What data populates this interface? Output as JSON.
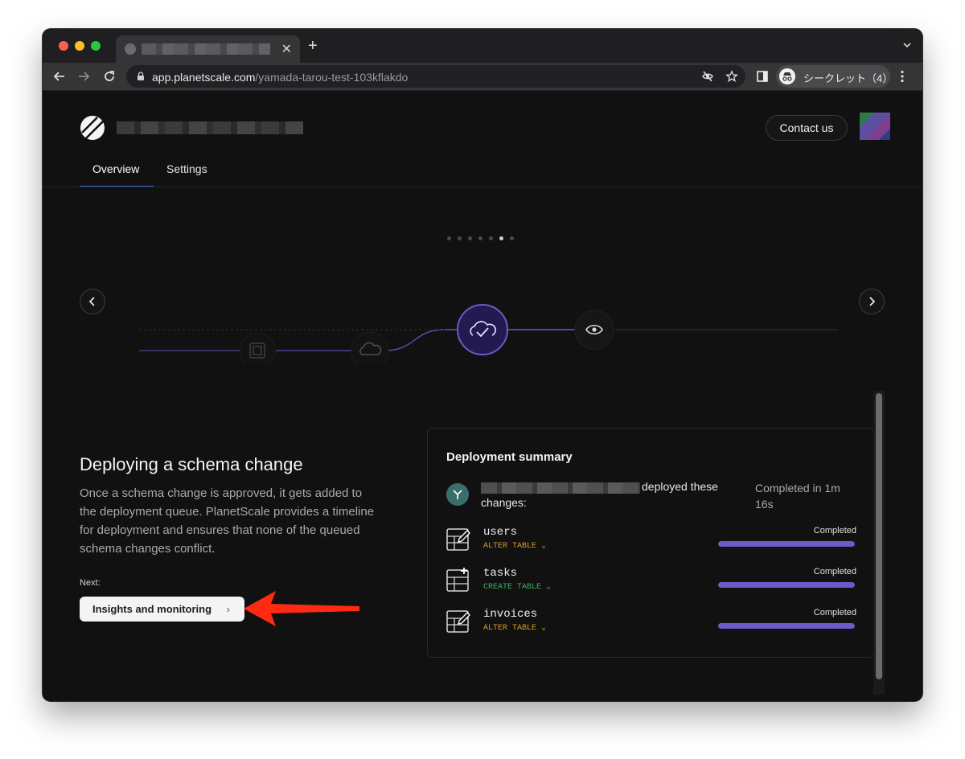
{
  "browser": {
    "tab_title": "",
    "new_tab_label": "+",
    "tab_close_label": "✕",
    "url_host": "app.planetscale.com",
    "url_path": "/yamada-tarou-test-103kflakdo",
    "incognito_label": "シークレット（4）"
  },
  "header": {
    "org_name": "",
    "contact_label": "Contact us"
  },
  "nav": {
    "tabs": [
      {
        "label": "Overview",
        "active": true
      },
      {
        "label": "Settings",
        "active": false
      }
    ]
  },
  "carousel": {
    "total_steps": 7,
    "active_index": 5,
    "prev_label": "‹",
    "next_label": "›",
    "steps": [
      "branch-icon",
      "cloud-icon",
      "cloud-check-icon",
      "eye-icon"
    ]
  },
  "content": {
    "heading": "Deploying a schema change",
    "description": "Once a schema change is approved, it gets added to the deployment queue. PlanetScale provides a timeline for deployment and ensures that none of the queued schema changes conflict.",
    "next_label": "Next:",
    "next_button": "Insights and monitoring",
    "next_button_chevron": "›"
  },
  "summary": {
    "title": "Deployment summary",
    "user": "",
    "deployed_text": "deployed these",
    "changes_text": "changes:",
    "completed_text": "Completed in 1m 16s",
    "items": [
      {
        "name": "users",
        "operation": "ALTER TABLE ⌄",
        "op_type": "alter",
        "status": "Completed",
        "progress": 1.0
      },
      {
        "name": "tasks",
        "operation": "CREATE TABLE ⌄",
        "op_type": "create",
        "status": "Completed",
        "progress": 1.0
      },
      {
        "name": "invoices",
        "operation": "ALTER TABLE ⌄",
        "op_type": "alter",
        "status": "Completed",
        "progress": 1.0
      }
    ]
  },
  "colors": {
    "accent_purple": "#6a5bc6",
    "nav_underline": "#3b6bd6",
    "alter": "#d99a22",
    "create": "#3fae5a",
    "callout_arrow": "#ff2a12"
  }
}
